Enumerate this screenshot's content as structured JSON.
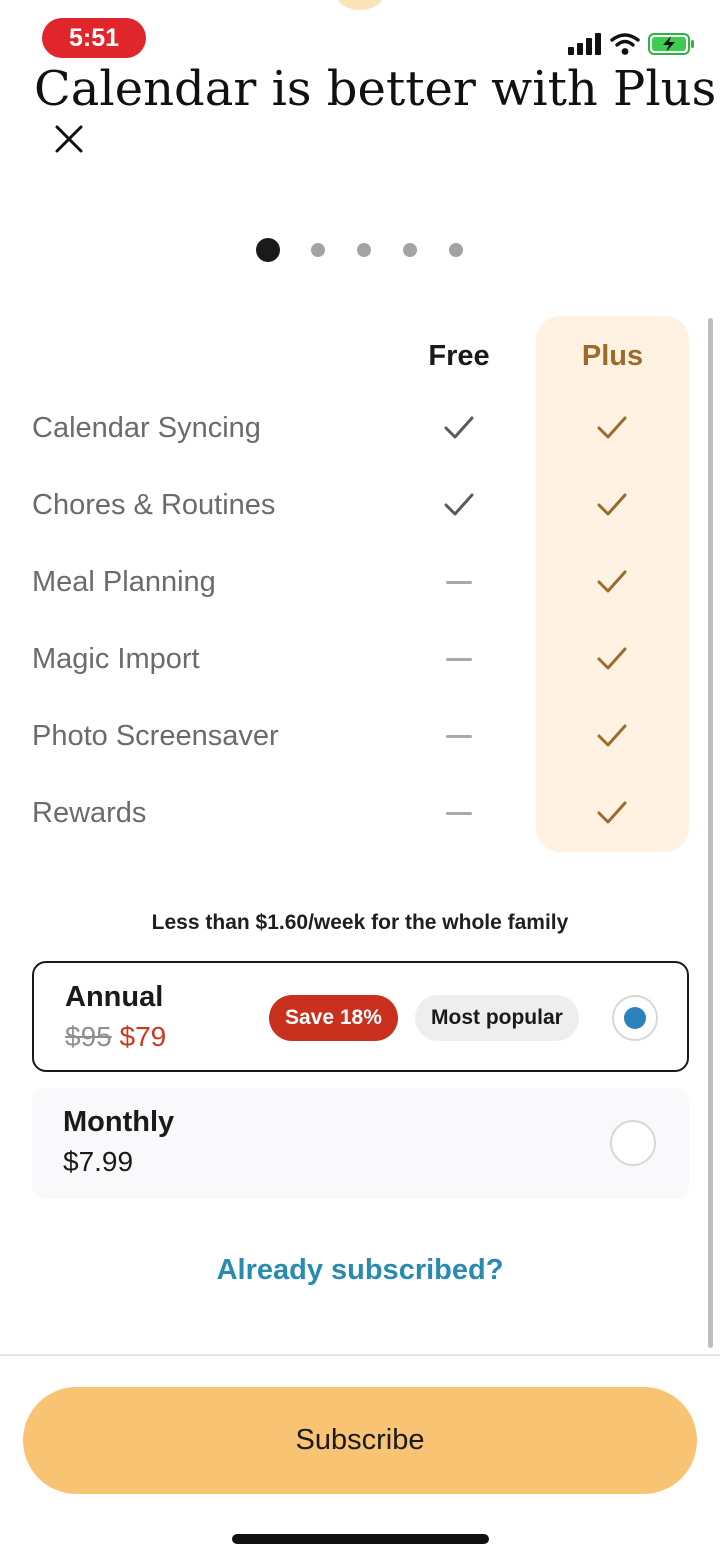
{
  "status_bar": {
    "time": "5:51"
  },
  "header": {
    "title": "Calendar is better with Plus"
  },
  "carousel": {
    "count": 5,
    "active_index": 0
  },
  "comparison": {
    "free_label": "Free",
    "plus_label": "Plus",
    "features": [
      {
        "label": "Calendar Syncing",
        "free": true,
        "plus": true
      },
      {
        "label": "Chores & Routines",
        "free": true,
        "plus": true
      },
      {
        "label": "Meal Planning",
        "free": false,
        "plus": true
      },
      {
        "label": "Magic Import",
        "free": false,
        "plus": true
      },
      {
        "label": "Photo Screensaver",
        "free": false,
        "plus": true
      },
      {
        "label": "Rewards",
        "free": false,
        "plus": true
      }
    ]
  },
  "pricing": {
    "tagline": "Less than $1.60/week for the whole family",
    "annual": {
      "name": "Annual",
      "old_price": "$95",
      "new_price": "$79",
      "save_badge": "Save 18%",
      "popular_badge": "Most popular",
      "selected": true
    },
    "monthly": {
      "name": "Monthly",
      "price": "$7.99",
      "selected": false
    }
  },
  "links": {
    "already_subscribed": "Already subscribed?"
  },
  "footer": {
    "subscribe_label": "Subscribe"
  },
  "colors": {
    "accent_plus": "#9c6a2a",
    "plus_column_bg": "#fff2e2",
    "save_badge_bg": "#c9311e",
    "link": "#2a8bb0",
    "subscribe_bg": "#f8c373",
    "radio_selected": "#2a83bd"
  }
}
